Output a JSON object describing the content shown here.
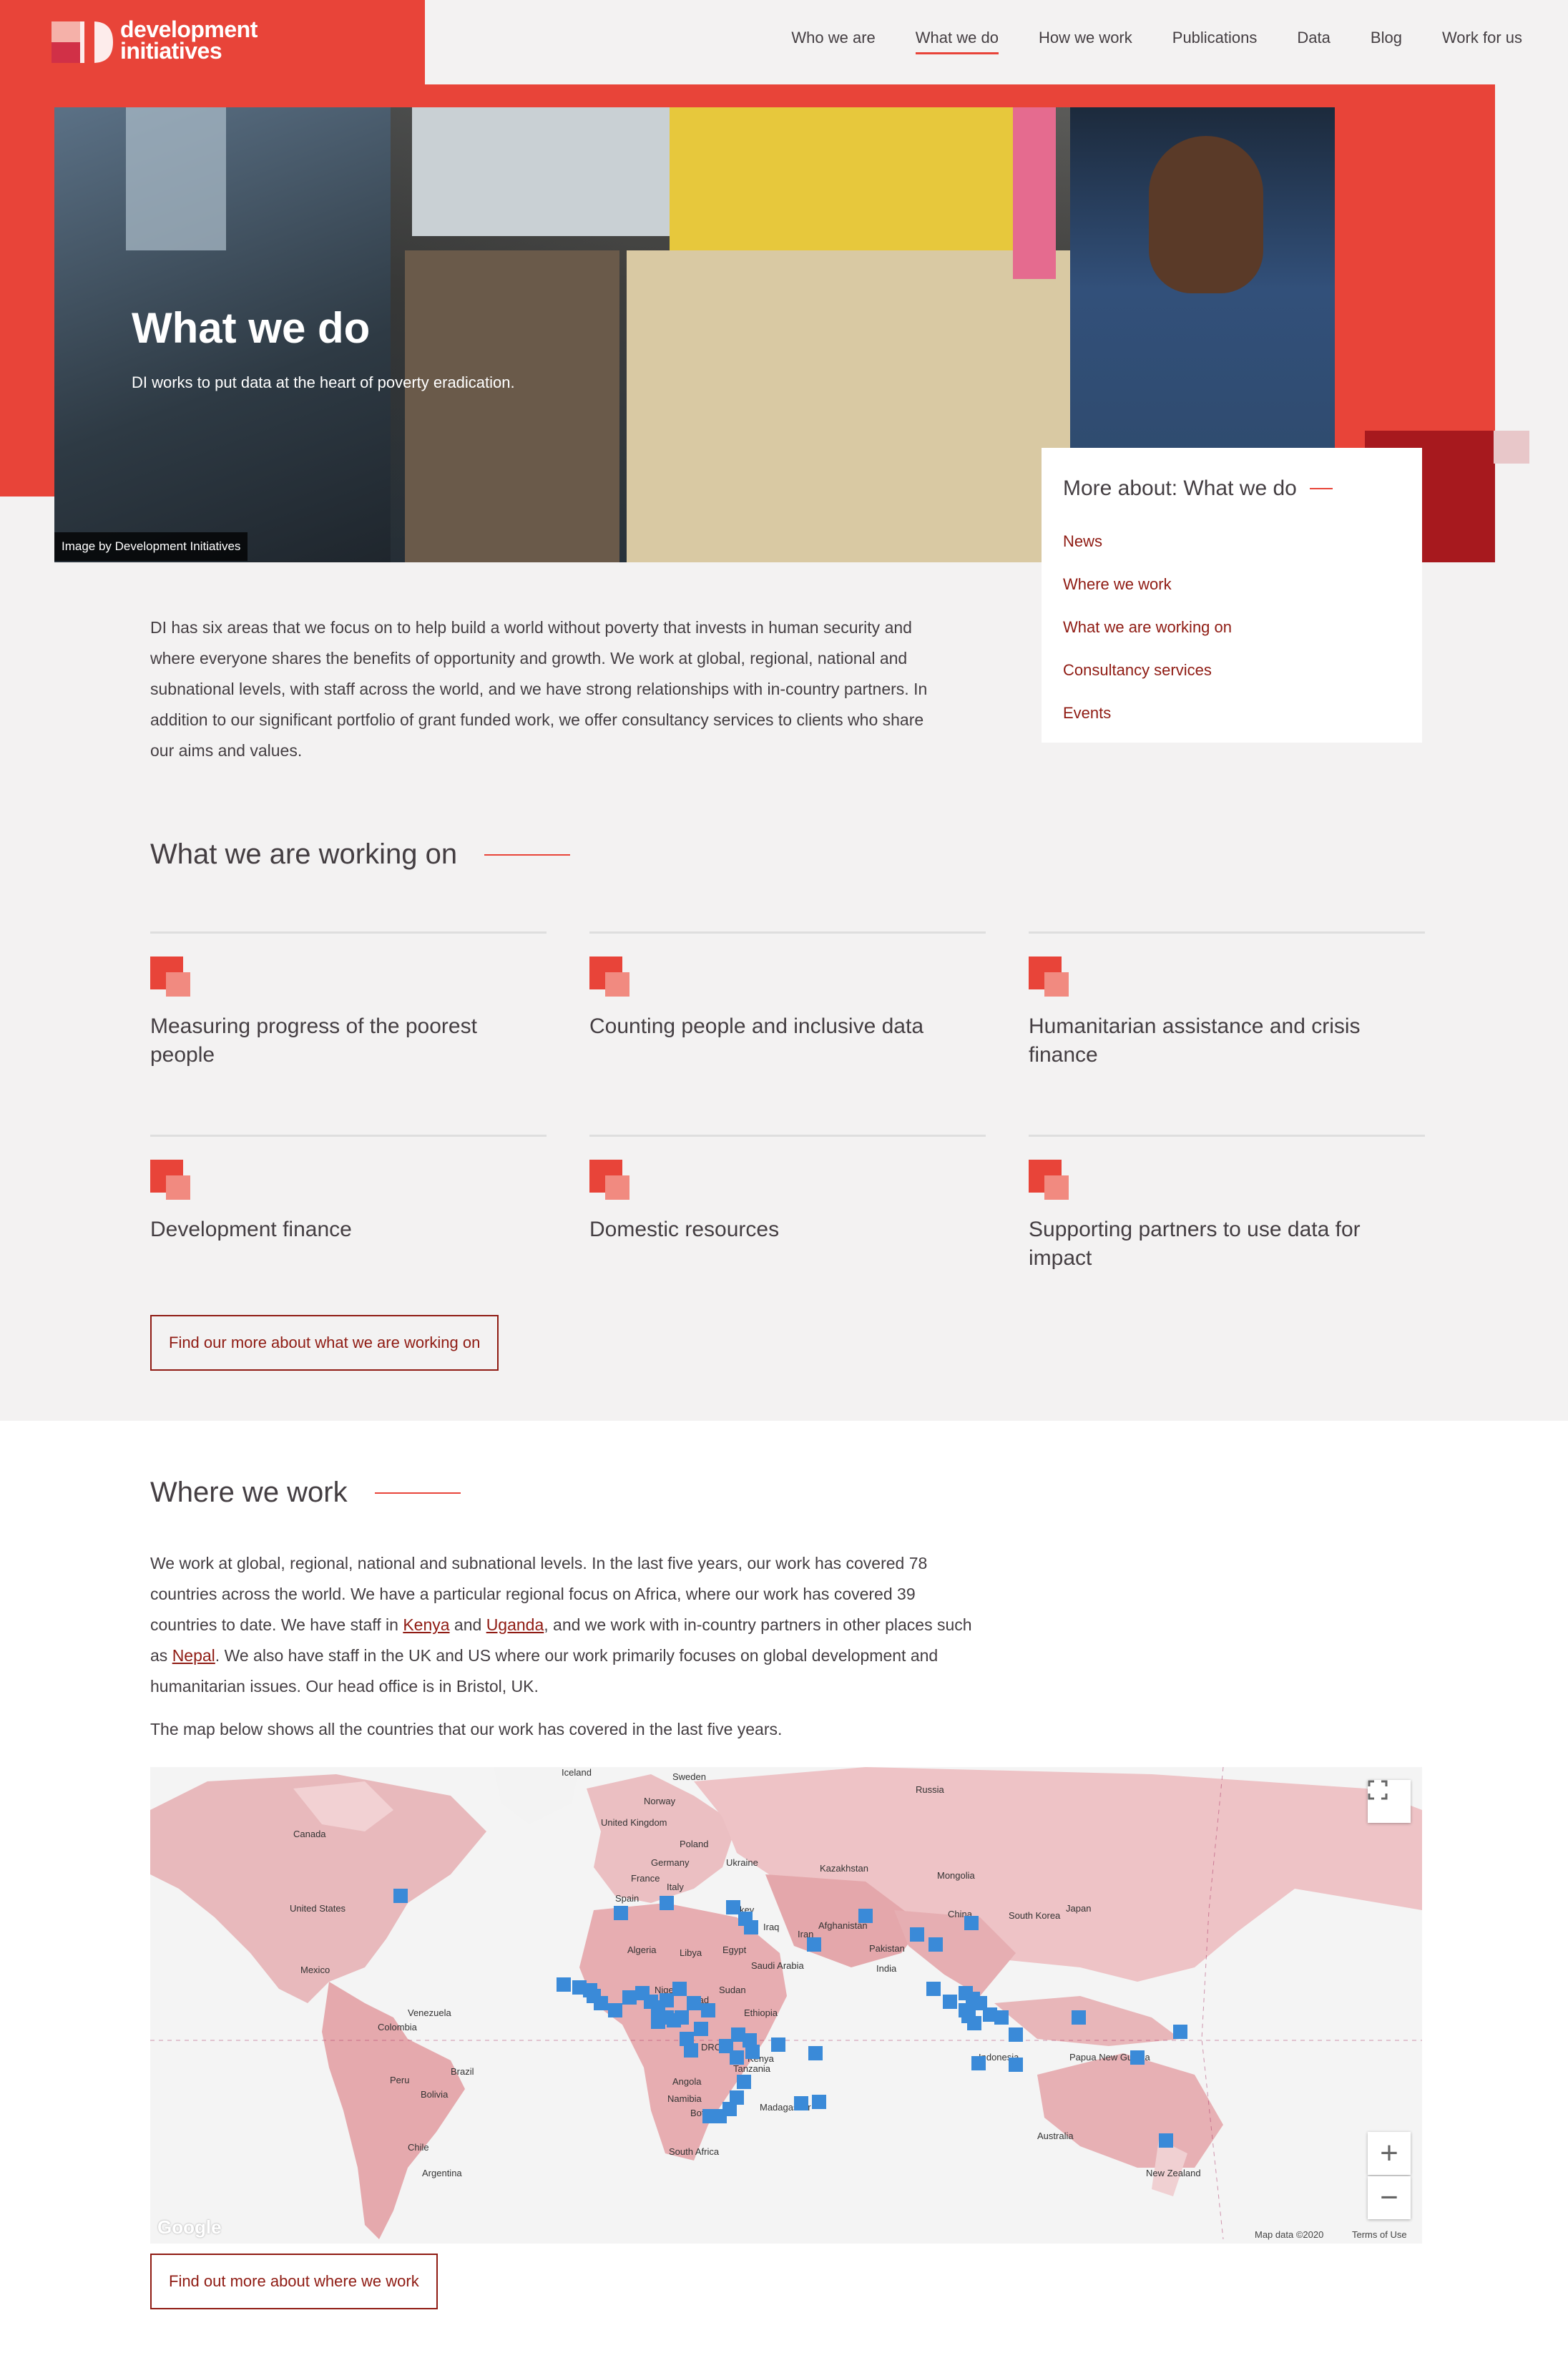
{
  "brand": {
    "line1": "development",
    "line2": "initiatives"
  },
  "nav": [
    {
      "label": "Who we are",
      "active": false
    },
    {
      "label": "What we do",
      "active": true
    },
    {
      "label": "How we work",
      "active": false
    },
    {
      "label": "Publications",
      "active": false
    },
    {
      "label": "Data",
      "active": false
    },
    {
      "label": "Blog",
      "active": false
    },
    {
      "label": "Work for us",
      "active": false
    }
  ],
  "hero": {
    "title": "What we do",
    "subtitle": "DI works to put data at the heart of poverty eradication.",
    "credit": "Image by Development Initiatives"
  },
  "more_about": {
    "title": "More about: What we do",
    "links": [
      "News",
      "Where we work",
      "What we are working on",
      "Consultancy services",
      "Events"
    ]
  },
  "intro": "DI has six areas that we focus on to help build a world without poverty that invests in human security and where everyone shares the benefits of opportunity and growth. We work at global, regional, national and subnational levels, with staff across the world, and we have strong relationships with in-country partners. In addition to our significant portfolio of grant funded work, we offer consultancy services to clients who share our aims and values.",
  "working_on": {
    "title": "What we are working on",
    "cards": [
      "Measuring progress of the poorest people",
      "Counting people and inclusive data",
      "Humanitarian assistance and crisis finance",
      "Development finance",
      "Domestic resources",
      "Supporting partners to use data for impact"
    ],
    "button": "Find our more about what we are working on"
  },
  "where_we_work": {
    "title": "Where we work",
    "p1_a": "We work at global, regional, national and subnational levels. In the last five years, our work has covered 78 countries across the world. We have a particular regional focus on Africa, where our work has covered 39 countries to date. We have staff in ",
    "link_kenya": "Kenya",
    "p1_and": " and ",
    "link_uganda": "Uganda",
    "p1_b": ", and we work with in-country partners in other places such as ",
    "link_nepal": "Nepal",
    "p1_c": ". We also have staff in the UK and US where our work primarily focuses on global development and humanitarian issues. Our head office is in Bristol, UK.",
    "map_note": "The map below shows all the countries that our work has covered in the last five years.",
    "button": "Find out more about where we work"
  },
  "map": {
    "labels": [
      "Iceland",
      "Sweden",
      "Norway",
      "Russia",
      "United Kingdom",
      "Poland",
      "Canada",
      "Germany",
      "Ukraine",
      "Kazakhstan",
      "France",
      "Mongolia",
      "Italy",
      "Spain",
      "United States",
      "Turkey",
      "Japan",
      "China",
      "South Korea",
      "Iraq",
      "Afghanistan",
      "Iran",
      "Algeria",
      "Libya",
      "Egypt",
      "Pakistan",
      "Saudi Arabia",
      "India",
      "Mexico",
      "Niger",
      "Sudan",
      "Chad",
      "Ethiopia",
      "Venezuela",
      "Colombia",
      "DRC",
      "Kenya",
      "Indonesia",
      "Tanzania",
      "Papua New Guinea",
      "Brazil",
      "Peru",
      "Angola",
      "Bolivia",
      "Namibia",
      "Madagascar",
      "Botswana",
      "Australia",
      "Chile",
      "South Africa",
      "New Zealand",
      "Argentina"
    ],
    "attribution": "Map data ©2020",
    "terms": "Terms of Use",
    "google": "Google",
    "zoom_in": "+",
    "zoom_out": "−",
    "marker_color": "#3a8ad8"
  },
  "colors": {
    "brand_red": "#e84439",
    "dark_red": "#a7191e",
    "link_red": "#8f1b13"
  }
}
